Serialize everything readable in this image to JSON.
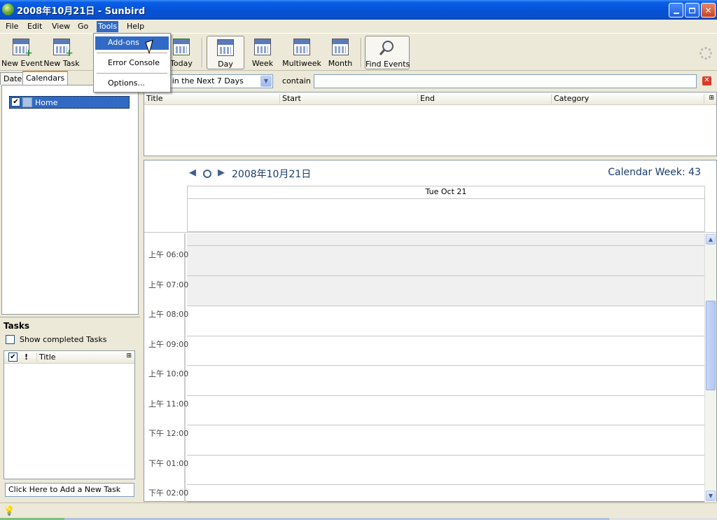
{
  "window": {
    "title": "2008年10月21日 - Sunbird"
  },
  "menubar": {
    "items": [
      {
        "label": "File"
      },
      {
        "label": "Edit"
      },
      {
        "label": "View"
      },
      {
        "label": "Go"
      },
      {
        "label": "Tools"
      },
      {
        "label": "Help"
      }
    ]
  },
  "tools_menu": {
    "items": [
      {
        "label": "Add-ons"
      },
      {
        "label": "Error Console"
      },
      {
        "label": "Options..."
      }
    ]
  },
  "toolbar": {
    "new_event": "New Event",
    "new_task": "New Task",
    "today": "Today",
    "day": "Day",
    "week": "Week",
    "multiweek": "Multiweek",
    "month": "Month",
    "find_events": "Find Events"
  },
  "left_tabs": {
    "date": "Date",
    "calendars": "Calendars"
  },
  "calendars": [
    {
      "name": "Home",
      "checked": true,
      "color": "#a8c2e0"
    }
  ],
  "tasks": {
    "title": "Tasks",
    "show_completed": "Show completed Tasks",
    "column_title": "Title",
    "priority_glyph": "!",
    "new_task_placeholder": "Click Here to Add a New Task"
  },
  "filter": {
    "selected": "Events in the Next 7 Days",
    "contain_label": "contain",
    "search_value": ""
  },
  "event_list": {
    "columns": [
      "Title",
      "Start",
      "End",
      "Category"
    ]
  },
  "day_view": {
    "date_label": "2008年10月21日",
    "calendar_week": "Calendar Week: 43",
    "day_header": "Tue Oct 21",
    "hours": [
      "上午 06:00",
      "上午 07:00",
      "上午 08:00",
      "上午 09:00",
      "上午 10:00",
      "上午 11:00",
      "下午 12:00",
      "下午 01:00",
      "下午 02:00"
    ]
  },
  "colors": {
    "selection": "#316ac5",
    "titlebar": "#0553d8",
    "tab_accent": "#e68b2c"
  }
}
